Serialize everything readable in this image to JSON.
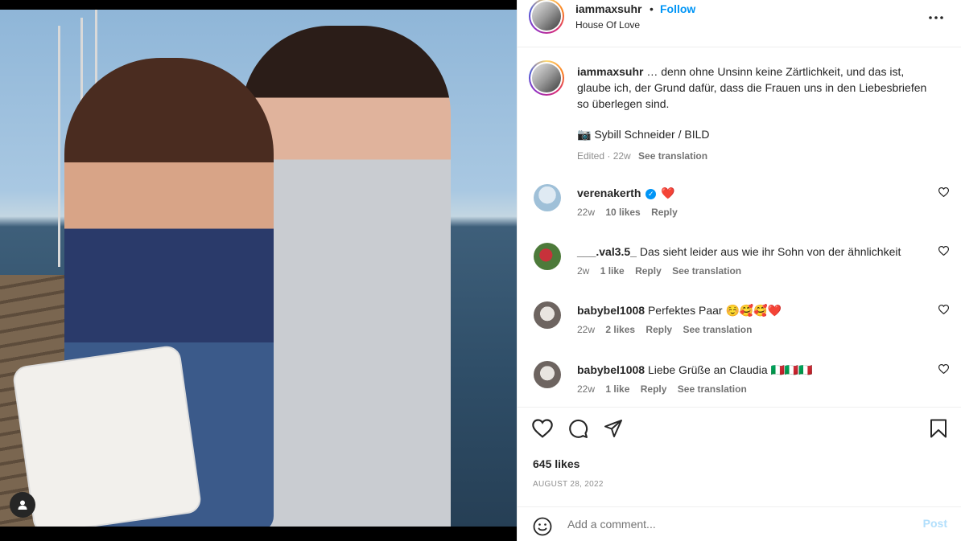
{
  "post": {
    "username": "iammaxsuhr",
    "dot": "•",
    "follow_label": "Follow",
    "location": "House Of Love"
  },
  "caption": {
    "username": "iammaxsuhr",
    "text": "… denn ohne Unsinn keine Zärtlichkeit, und das ist, glaube ich, der Grund dafür, dass die Frauen uns in den Liebesbriefen so überlegen sind.",
    "credit": "📷 Sybill Schneider / BILD",
    "meta": "Edited · 22w",
    "see_translation": "See translation"
  },
  "comments": [
    {
      "username": "verenakerth",
      "verified": true,
      "text": "❤️",
      "age": "22w",
      "likes": "10 likes",
      "reply": "Reply",
      "translation": ""
    },
    {
      "username": "___.val3.5_",
      "verified": false,
      "text": "Das sieht leider aus wie ihr Sohn von der ähnlichkeit",
      "age": "2w",
      "likes": "1 like",
      "reply": "Reply",
      "translation": "See translation"
    },
    {
      "username": "babybel1008",
      "verified": false,
      "text": "Perfektes Paar ☺️🥰🥰❤️",
      "age": "22w",
      "likes": "2 likes",
      "reply": "Reply",
      "translation": "See translation"
    },
    {
      "username": "babybel1008",
      "verified": false,
      "text": "Liebe Grüße an Claudia 🇮🇹🇮🇹🇮🇹",
      "age": "22w",
      "likes": "1 like",
      "reply": "Reply",
      "translation": "See translation"
    }
  ],
  "actions": {
    "likes": "645 likes",
    "date": "AUGUST 28, 2022"
  },
  "add_comment": {
    "placeholder": "Add a comment...",
    "post_label": "Post"
  },
  "colors": {
    "accent": "#0095f6",
    "post_disabled": "#b2dffc",
    "heart_red": "#ed4956"
  },
  "icons": [
    "more-icon",
    "heart-icon",
    "comment-icon",
    "share-icon",
    "bookmark-icon",
    "emoji-icon",
    "user-tag-icon",
    "verified-icon"
  ]
}
